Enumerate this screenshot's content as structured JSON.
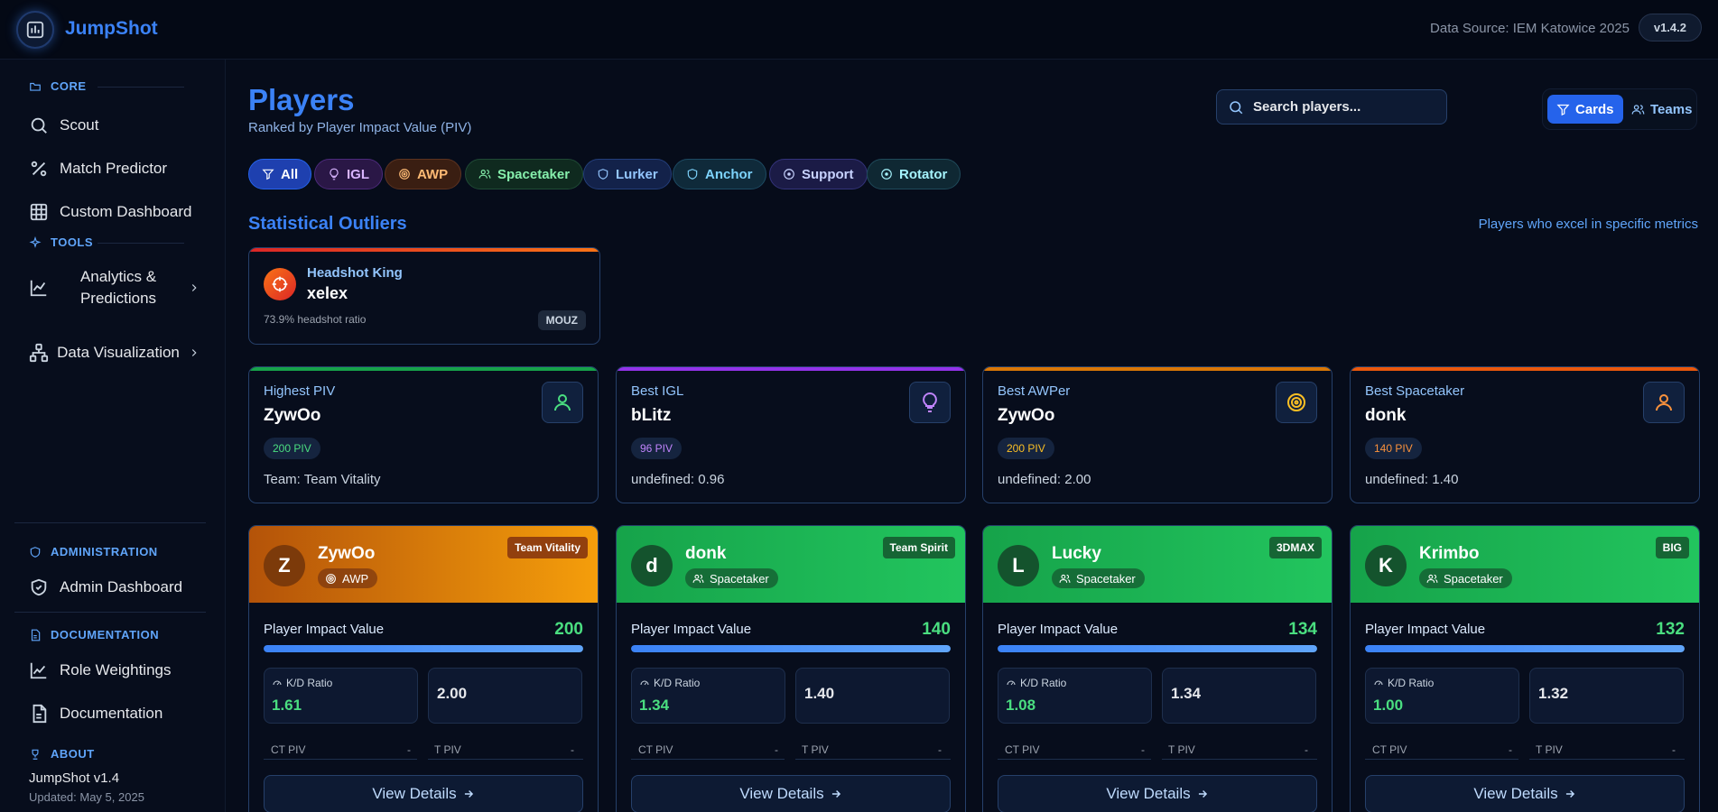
{
  "app": {
    "brand": "JumpShot",
    "data_source": "Data Source: IEM Katowice 2025",
    "version": "v1.4.2"
  },
  "sidebar": {
    "core": {
      "header": "CORE",
      "items": [
        {
          "label": "Scout"
        },
        {
          "label": "Match Predictor"
        },
        {
          "label": "Custom Dashboard"
        }
      ]
    },
    "tools": {
      "header": "TOOLS",
      "items": [
        {
          "label": "Analytics & Predictions"
        },
        {
          "label": "Data Visualization"
        }
      ]
    },
    "administration": {
      "header": "ADMINISTRATION",
      "items": [
        {
          "label": "Admin Dashboard"
        }
      ]
    },
    "documentation": {
      "header": "DOCUMENTATION",
      "items": [
        {
          "label": "Role Weightings"
        },
        {
          "label": "Documentation"
        }
      ]
    },
    "about": {
      "header": "ABOUT",
      "title": "JumpShot v1.4",
      "updated": "Updated: May 5, 2025"
    }
  },
  "main": {
    "title": "Players",
    "subtitle": "Ranked by Player Impact Value (PIV)",
    "search": {
      "placeholder": "Search players..."
    },
    "view_toggle": {
      "cards": "Cards",
      "teams": "Teams"
    },
    "filters": [
      {
        "label": "All",
        "icon": "filter-icon",
        "active": true
      },
      {
        "label": "IGL",
        "icon": "lightbulb-icon"
      },
      {
        "label": "AWP",
        "icon": "target-icon"
      },
      {
        "label": "Spacetaker",
        "icon": "users-icon"
      },
      {
        "label": "Lurker",
        "icon": "shield-icon"
      },
      {
        "label": "Anchor",
        "icon": "shield-icon"
      },
      {
        "label": "Support",
        "icon": "circle-dot-icon"
      },
      {
        "label": "Rotator",
        "icon": "circle-dot-icon"
      }
    ],
    "outliers": {
      "title": "Statistical Outliers",
      "note": "Players who excel in specific metrics",
      "headshot": {
        "label": "Headshot King",
        "name": "xelex",
        "stat": "73.9% headshot ratio",
        "team": "MOUZ"
      }
    },
    "best": [
      {
        "label": "Highest PIV",
        "name": "ZywOo",
        "piv": "200 PIV",
        "extra": "Team: Team Vitality",
        "color": "#22c55e"
      },
      {
        "label": "Best IGL",
        "name": "bLitz",
        "piv": "96 PIV",
        "extra": "undefined: 0.96",
        "color": "#a855f7"
      },
      {
        "label": "Best AWPer",
        "name": "ZywOo",
        "piv": "200 PIV",
        "extra": "undefined: 2.00",
        "color": "#f59e0b"
      },
      {
        "label": "Best Spacetaker",
        "name": "donk",
        "piv": "140 PIV",
        "extra": "undefined: 1.40",
        "color": "#f97316"
      }
    ],
    "players": [
      {
        "initial": "Z",
        "name": "ZywOo",
        "role": "AWP",
        "team": "Team Vitality",
        "piv_label": "Player Impact Value",
        "piv": "200",
        "piv_fill": 1.0,
        "kd_label": "K/D Ratio",
        "kd": "1.61",
        "secondary": "2.00",
        "ct_label": "CT PIV",
        "ct_val": "-",
        "t_label": "T PIV",
        "t_val": "-",
        "button": "View Details"
      },
      {
        "initial": "d",
        "name": "donk",
        "role": "Spacetaker",
        "team": "Team Spirit",
        "piv_label": "Player Impact Value",
        "piv": "140",
        "piv_fill": 1.0,
        "kd_label": "K/D Ratio",
        "kd": "1.34",
        "secondary": "1.40",
        "ct_label": "CT PIV",
        "ct_val": "-",
        "t_label": "T PIV",
        "t_val": "-",
        "button": "View Details"
      },
      {
        "initial": "L",
        "name": "Lucky",
        "role": "Spacetaker",
        "team": "3DMAX",
        "piv_label": "Player Impact Value",
        "piv": "134",
        "piv_fill": 1.0,
        "kd_label": "K/D Ratio",
        "kd": "1.08",
        "secondary": "1.34",
        "ct_label": "CT PIV",
        "ct_val": "-",
        "t_label": "T PIV",
        "t_val": "-",
        "button": "View Details"
      },
      {
        "initial": "K",
        "name": "Krimbo",
        "role": "Spacetaker",
        "team": "BIG",
        "piv_label": "Player Impact Value",
        "piv": "132",
        "piv_fill": 1.0,
        "kd_label": "K/D Ratio",
        "kd": "1.00",
        "secondary": "1.32",
        "ct_label": "CT PIV",
        "ct_val": "-",
        "t_label": "T PIV",
        "t_val": "-",
        "button": "View Details"
      }
    ]
  }
}
